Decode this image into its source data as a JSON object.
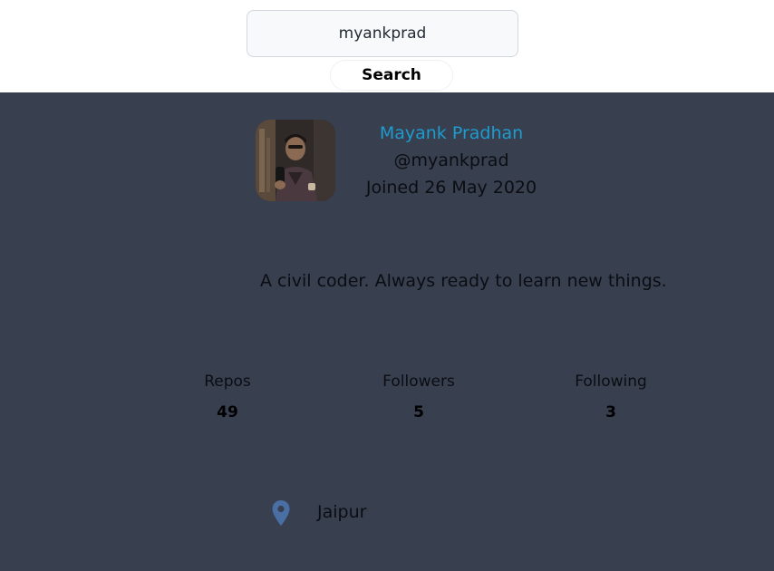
{
  "search": {
    "value": "myankprad",
    "button_label": "Search"
  },
  "profile": {
    "name": "Mayank Pradhan",
    "handle": "@myankprad",
    "joined": "Joined 26 May 2020",
    "bio": "A civil coder. Always ready to learn new things.",
    "avatar": "avatar-photo"
  },
  "stats": {
    "repos_label": "Repos",
    "repos_value": "49",
    "followers_label": "Followers",
    "followers_value": "5",
    "following_label": "Following",
    "following_value": "3"
  },
  "location": {
    "icon": "map-pin-icon",
    "text": "Jaipur"
  },
  "colors": {
    "panel_bg": "#383f4f",
    "name_link": "#1e9bcf",
    "pin": "#4a6fa5"
  }
}
